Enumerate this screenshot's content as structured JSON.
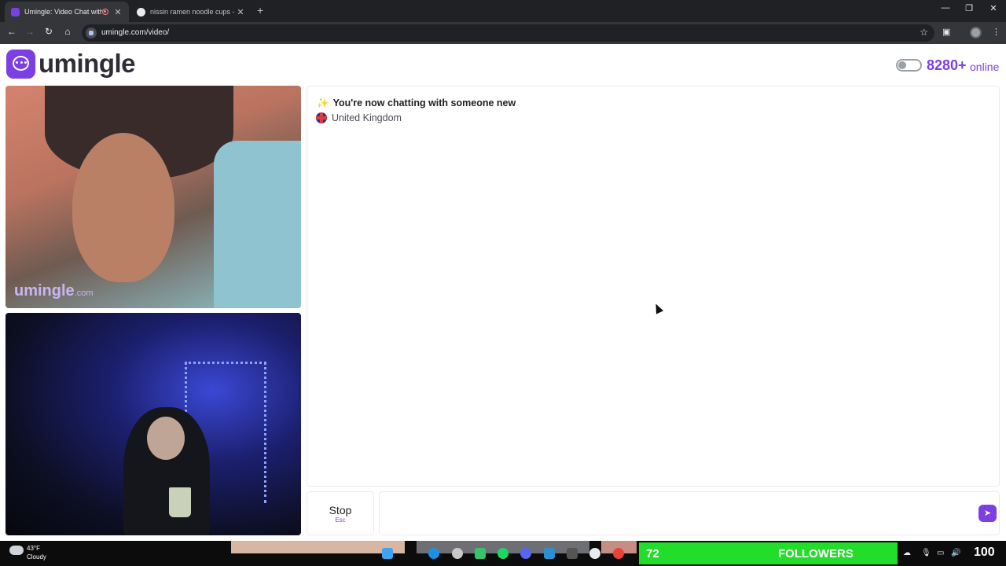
{
  "browser": {
    "tabs": [
      {
        "title": "Umingle: Video Chat with S",
        "active": true
      },
      {
        "title": "nissin ramen noodle cups - Goo",
        "active": false
      }
    ],
    "url": "umingle.com/video/",
    "icons": [
      "back-icon",
      "forward-icon",
      "reload-icon",
      "home-icon",
      "star-icon",
      "sidepanel-icon",
      "menu-icon"
    ]
  },
  "header": {
    "logo_text": "umingle",
    "online_count": "8280+",
    "online_label": "online"
  },
  "video": {
    "watermark": "umingle",
    "watermark_suffix": ".com"
  },
  "chat": {
    "status_emoji": "✨",
    "status_text": "You're now chatting with someone new",
    "country": "United Kingdom",
    "message_value": ""
  },
  "controls": {
    "stop_label": "Stop",
    "stop_shortcut": "Esc",
    "send_icon": "send-icon"
  },
  "taskbar": {
    "temperature": "43°F",
    "condition": "Cloudy",
    "followers_count": "72",
    "followers_label": "FOLLOWERS",
    "overlay_number": "100"
  },
  "colors": {
    "brand_purple": "#7b3fe4",
    "followers_green": "#22dd2a",
    "chrome_dark": "#202124"
  }
}
